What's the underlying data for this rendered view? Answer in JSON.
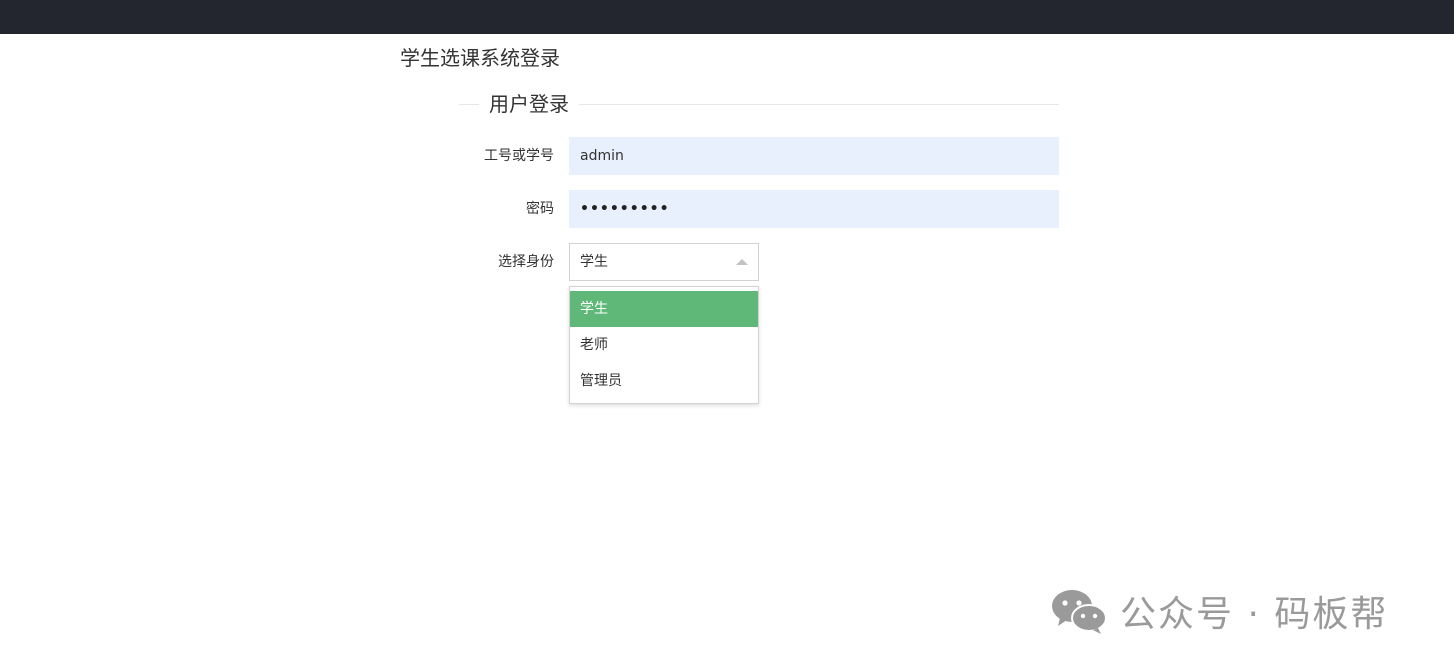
{
  "page": {
    "title": "学生选课系统登录",
    "legend": "用户登录"
  },
  "form": {
    "username": {
      "label": "工号或学号",
      "value": "admin"
    },
    "password": {
      "label": "密码",
      "masked_value": "•••••••••"
    },
    "role": {
      "label": "选择身份",
      "selected": "学生",
      "options": [
        "学生",
        "老师",
        "管理员"
      ]
    }
  },
  "watermark": {
    "text": "公众号 · 码板帮",
    "icon": "wechat-icon"
  },
  "colors": {
    "topbar": "#23262e",
    "input_bg": "#e8f0fe",
    "selected_option": "#5fb878"
  }
}
